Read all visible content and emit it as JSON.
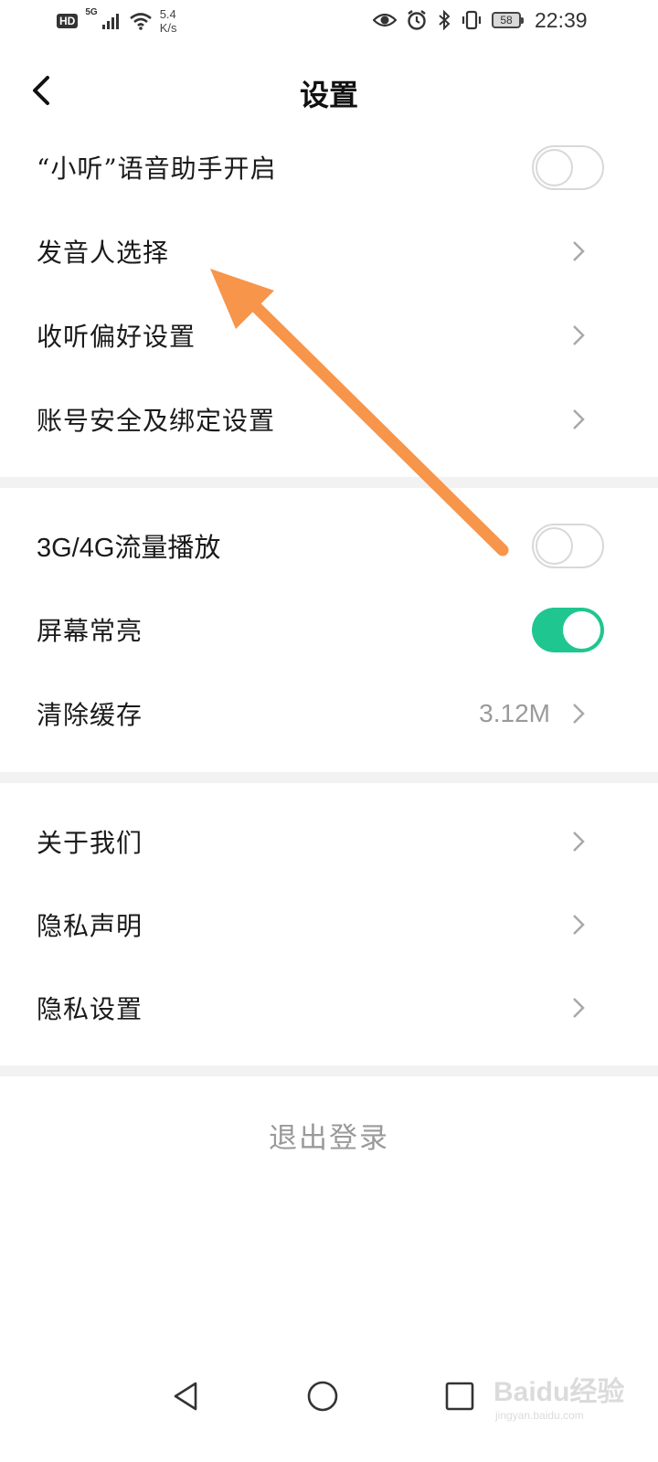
{
  "status_bar": {
    "hd_label": "HD",
    "network_label": "5G",
    "speed_value": "5.4",
    "speed_unit": "K/s",
    "battery_level": "58",
    "time": "22:39"
  },
  "header": {
    "title": "设置"
  },
  "sections": [
    {
      "items": [
        {
          "label": "“小听”语音助手开启",
          "type": "toggle",
          "enabled": false
        },
        {
          "label": "发音人选择",
          "type": "link"
        },
        {
          "label": "收听偏好设置",
          "type": "link"
        },
        {
          "label": "账号安全及绑定设置",
          "type": "link"
        }
      ]
    },
    {
      "items": [
        {
          "label": "3G/4G流量播放",
          "type": "toggle",
          "enabled": false
        },
        {
          "label": "屏幕常亮",
          "type": "toggle",
          "enabled": true
        },
        {
          "label": "清除缓存",
          "type": "link",
          "value": "3.12M"
        }
      ]
    },
    {
      "items": [
        {
          "label": "关于我们",
          "type": "link"
        },
        {
          "label": "隐私声明",
          "type": "link"
        },
        {
          "label": "隐私设置",
          "type": "link"
        }
      ]
    }
  ],
  "logout_label": "退出登录",
  "watermark": {
    "brand": "Baidu经验",
    "url": "jingyan.baidu.com"
  },
  "colors": {
    "toggle_on": "#1fc690",
    "toggle_off_border": "#d8d8d8",
    "annotation_arrow": "#f7954a",
    "divider": "#f2f2f2"
  }
}
